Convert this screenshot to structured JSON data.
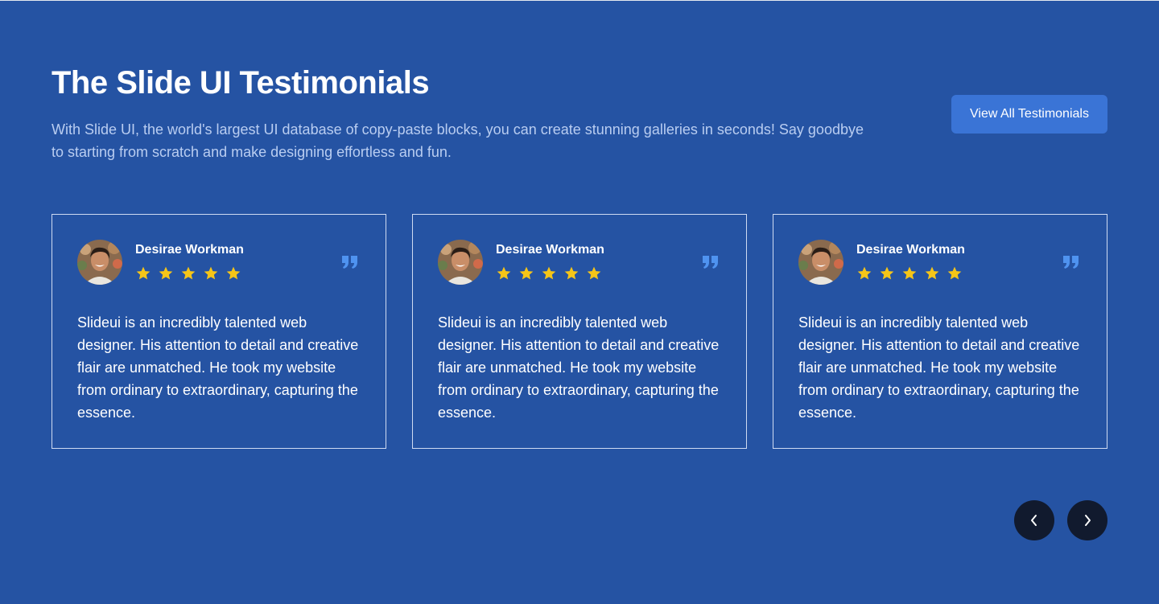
{
  "header": {
    "title": "The Slide UI Testimonials",
    "subtitle": "With Slide UI, the world's largest UI database of copy-paste blocks, you can create stunning galleries in seconds! Say goodbye to starting from scratch and make designing effortless and fun.",
    "view_all_label": "View All Testimonials"
  },
  "testimonials": [
    {
      "name": "Desirae Workman",
      "rating": 5,
      "text": "Slideui is an incredibly talented web designer. His attention to detail and creative flair are unmatched. He took my website from ordinary to extraordinary, capturing the essence."
    },
    {
      "name": "Desirae Workman",
      "rating": 5,
      "text": "Slideui is an incredibly talented web designer. His attention to detail and creative flair are unmatched. He took my website from ordinary to extraordinary, capturing the essence."
    },
    {
      "name": "Desirae Workman",
      "rating": 5,
      "text": "Slideui is an incredibly talented web designer. His attention to detail and creative flair are unmatched. He took my website from ordinary to extraordinary, capturing the essence."
    }
  ],
  "carousel": {
    "prev_icon": "chevron-left-icon",
    "next_icon": "chevron-right-icon"
  },
  "colors": {
    "background": "#2553a3",
    "button": "#3a74d6",
    "star": "#f5c518",
    "quote": "#4f93f0",
    "nav_button": "#111a2e"
  }
}
